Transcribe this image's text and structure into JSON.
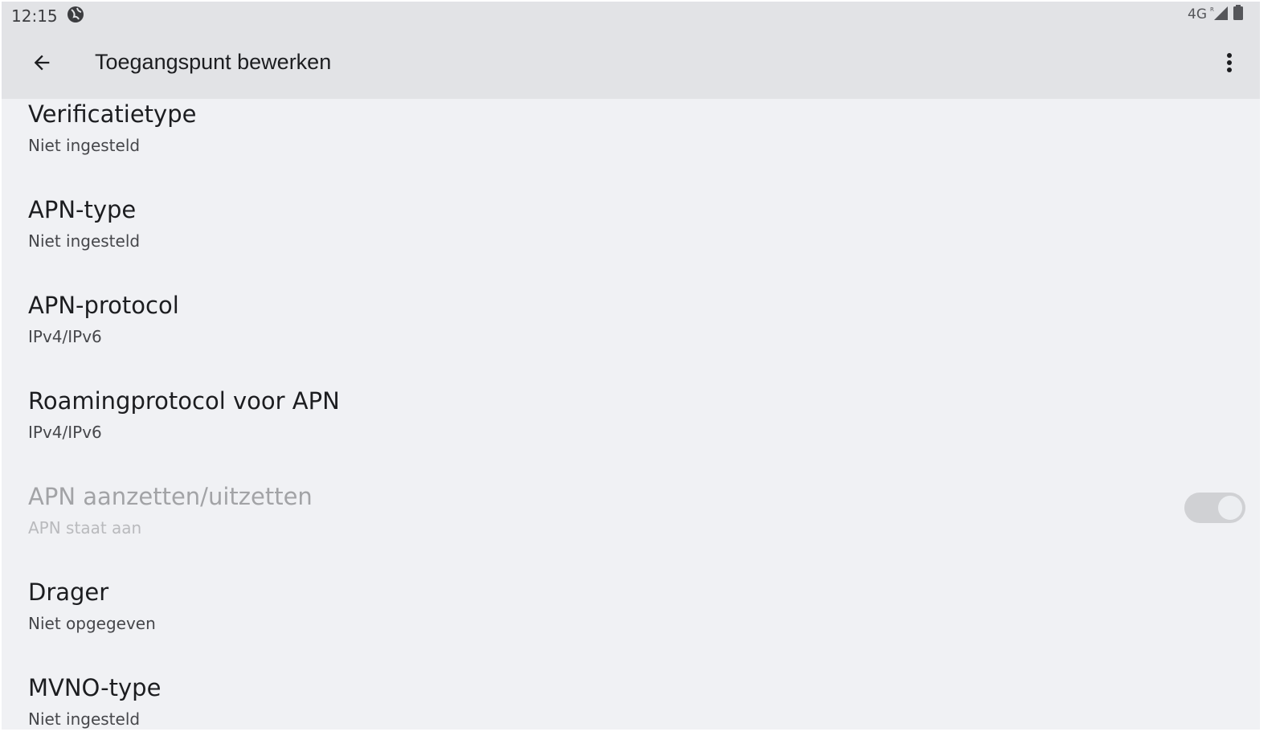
{
  "status_bar": {
    "time": "12:15",
    "network": "4G",
    "roaming_indicator": "R",
    "icons": [
      "globe-icon",
      "signal-icon",
      "battery-icon"
    ]
  },
  "app_bar": {
    "back_icon": "arrow-back-icon",
    "title": "Toegangspunt bewerken",
    "menu_icon": "more-vert-icon"
  },
  "preferences": [
    {
      "title": "Verificatietype",
      "summary": "Niet ingesteld",
      "enabled": true
    },
    {
      "title": "APN-type",
      "summary": "Niet ingesteld",
      "enabled": true
    },
    {
      "title": "APN-protocol",
      "summary": "IPv4/IPv6",
      "enabled": true
    },
    {
      "title": "Roamingprotocol voor APN",
      "summary": "IPv4/IPv6",
      "enabled": true
    },
    {
      "title": "APN aanzetten/uitzetten",
      "summary": "APN staat aan",
      "enabled": false,
      "switch_on": true
    },
    {
      "title": "Drager",
      "summary": "Niet opgegeven",
      "enabled": true
    },
    {
      "title": "MVNO-type",
      "summary": "Niet ingesteld",
      "enabled": true
    }
  ],
  "colors": {
    "app_bar_bg": "#e2e3e6",
    "page_bg": "#f0f1f4",
    "primary_text": "#1c1d20",
    "secondary_text": "#46474b",
    "disabled_text": "#a2a3a6"
  }
}
